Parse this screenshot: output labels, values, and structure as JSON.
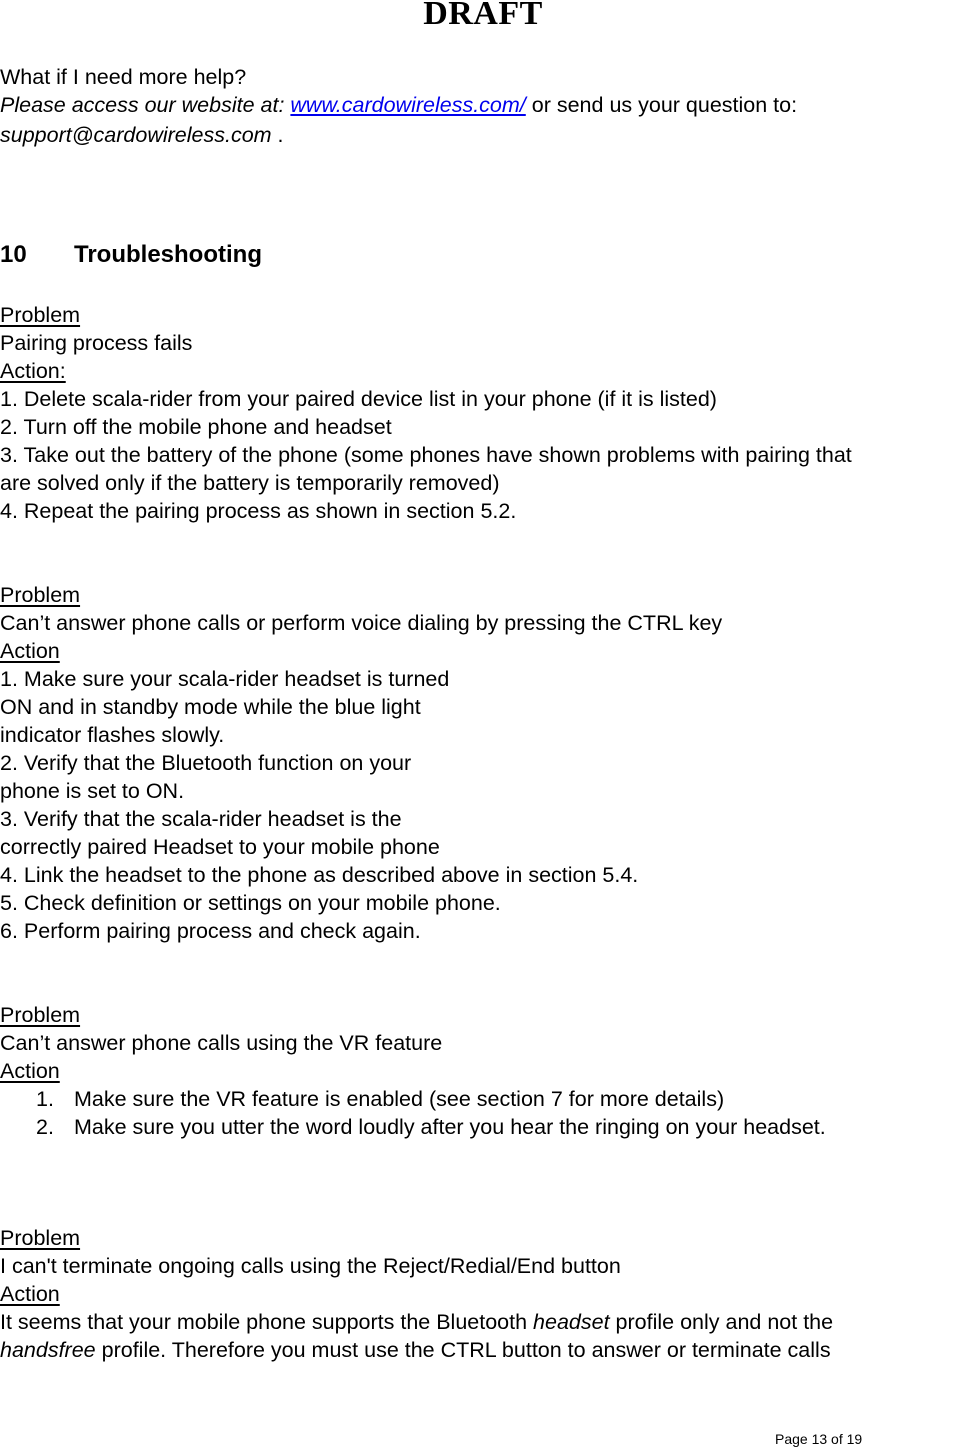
{
  "header": {
    "watermark": "DRAFT"
  },
  "help": {
    "question": "What if I need more help?",
    "prefix": "Please access our website at: ",
    "website_link": "www.cardowireless.com/",
    "middle": " or send us your question to:",
    "email": "support@cardowireless.com",
    "suffix": " ."
  },
  "section": {
    "number": "10",
    "title": "Troubleshooting"
  },
  "problems": [
    {
      "problem_label": "Problem",
      "problem": "Pairing process fails",
      "action_label": "Action:",
      "actions": [
        "1. Delete scala-rider from your paired device list in your phone (if it is listed)",
        "2. Turn off the mobile phone and headset",
        "3. Take out the battery of the phone (some phones have shown problems with pairing that",
        "are solved only if the battery is temporarily removed)",
        "4. Repeat the pairing process as shown in section 5.2."
      ]
    },
    {
      "problem_label": "Problem",
      "problem": "Can’t answer phone calls or perform voice dialing by pressing the CTRL key",
      "action_label": "Action",
      "actions": [
        "1. Make sure your scala-rider headset is turned",
        "ON and in standby mode while the blue light",
        "indicator flashes slowly.",
        "2. Verify that the Bluetooth function on your",
        "phone is set to ON.",
        "3. Verify that the scala-rider headset is the",
        "correctly paired Headset to your mobile phone",
        "4. Link the headset to the phone as described above in section 5.4.",
        "5. Check definition or settings on your mobile phone.",
        "6. Perform pairing process and check again."
      ]
    },
    {
      "problem_label": "Problem",
      "problem": "Can’t answer phone calls using the VR feature",
      "action_label": "Action",
      "actions": [
        {
          "num": "1.",
          "text": "Make sure the VR feature is enabled (see section 7 for more details)"
        },
        {
          "num": "2.",
          "text": "Make sure you utter the word loudly after you hear the ringing on your headset."
        }
      ]
    },
    {
      "problem_label": "Problem",
      "problem": "I can't terminate ongoing calls using the Reject/Redial/End button",
      "action_label": "Action",
      "body": {
        "p1": "It seems that your mobile phone supports the Bluetooth ",
        "em1": "headset",
        "p2": " profile only and not the",
        "em2": "handsfree",
        "p3": " profile. Therefore you must use the CTRL button to answer or terminate calls"
      }
    }
  ],
  "footer": {
    "page_label": "Page 13 of 19"
  }
}
